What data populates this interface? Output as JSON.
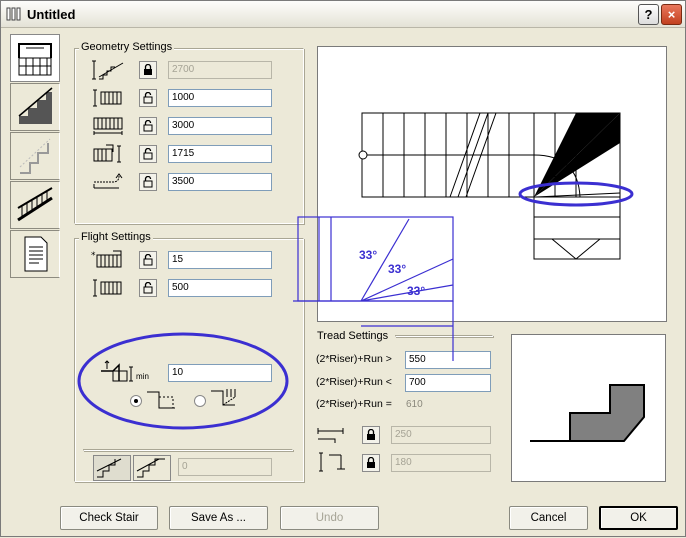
{
  "window": {
    "title": "Untitled",
    "help_label": "?",
    "close_label": "×"
  },
  "tabs": [
    {
      "name": "plan",
      "active": true
    },
    {
      "name": "stair-section"
    },
    {
      "name": "landing"
    },
    {
      "name": "railing"
    },
    {
      "name": "listing"
    }
  ],
  "geometry": {
    "label": "Geometry Settings",
    "rows": [
      {
        "icon": "total-height-icon",
        "value": "2700",
        "disabled": true
      },
      {
        "icon": "stair-width-icon",
        "value": "1000"
      },
      {
        "icon": "stair-length-icon",
        "value": "3000"
      },
      {
        "icon": "stair-offset-icon",
        "value": "1715"
      },
      {
        "icon": "walkline-length-icon",
        "value": "3500"
      }
    ]
  },
  "flight": {
    "label": "Flight Settings",
    "rows": [
      {
        "icon": "riser-count-icon",
        "value": "15"
      },
      {
        "icon": "flight-width-icon",
        "value": "500"
      }
    ],
    "min_value": "10",
    "min_label": "min",
    "segment_value": "0"
  },
  "tread": {
    "label": "Tread Settings",
    "rules": [
      {
        "label": "(2*Riser)+Run >",
        "value": "550"
      },
      {
        "label": "(2*Riser)+Run <",
        "value": "700"
      },
      {
        "label": "(2*Riser)+Run =",
        "value": "610"
      }
    ],
    "tread_depth": "250",
    "riser_height": "180"
  },
  "annotations": {
    "angles": [
      "33°",
      "33°",
      "33°"
    ],
    "accent": "#3b2fd1"
  },
  "buttons": {
    "check": "Check Stair",
    "save_as": "Save As ...",
    "undo": "Undo",
    "cancel": "Cancel",
    "ok": "OK"
  }
}
